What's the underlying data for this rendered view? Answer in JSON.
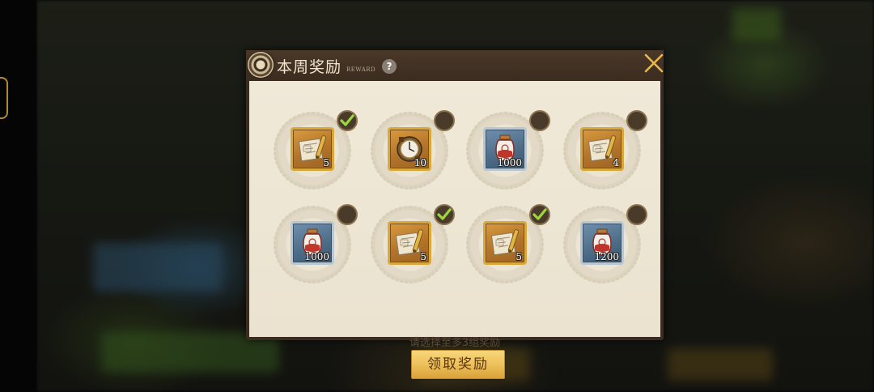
{
  "dialog": {
    "title": "本周奖励",
    "subtitle": "REWARD",
    "help_label": "?",
    "hint": "请选择至多3组奖励",
    "claim_label": "领取奖励"
  },
  "rewards": [
    {
      "icon": "blueprint-scroll-icon",
      "rarity": "gold",
      "qty": "5",
      "selected": true
    },
    {
      "icon": "compass-clock-icon",
      "rarity": "gold",
      "qty": "10",
      "selected": false
    },
    {
      "icon": "potion-jar-icon",
      "rarity": "blue",
      "qty": "1000",
      "selected": false
    },
    {
      "icon": "blueprint-scroll-icon",
      "rarity": "gold",
      "qty": "4",
      "selected": false
    },
    {
      "icon": "potion-jar-icon",
      "rarity": "blue",
      "qty": "1000",
      "selected": false
    },
    {
      "icon": "blueprint-scroll-icon",
      "rarity": "gold",
      "qty": "5",
      "selected": true
    },
    {
      "icon": "blueprint-scroll-icon",
      "rarity": "gold",
      "qty": "5",
      "selected": true
    },
    {
      "icon": "potion-jar-icon",
      "rarity": "blue",
      "qty": "1200",
      "selected": false
    }
  ],
  "colors": {
    "accent_gold": "#eec15a",
    "check_green": "#9bd83a",
    "panel_bg": "#ebe3d0"
  }
}
